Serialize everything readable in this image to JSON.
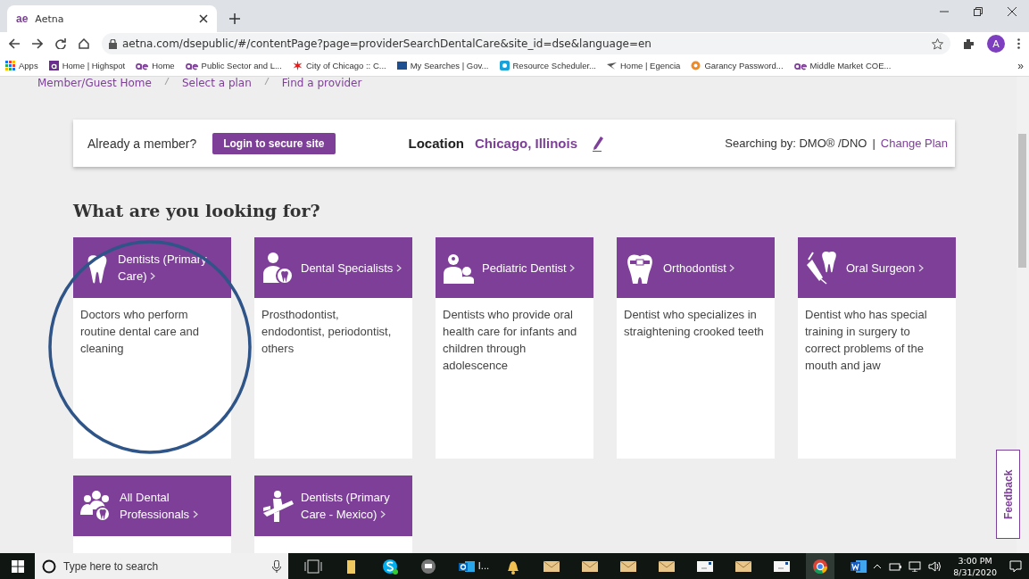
{
  "browser": {
    "tab": {
      "title": "Aetna",
      "logo": "ae"
    },
    "url": "aetna.com/dsepublic/#/contentPage?page=providerSearchDentalCare&site_id=dse&language=en",
    "profile": "A",
    "bookmarks": [
      {
        "label": "Apps",
        "kind": "apps"
      },
      {
        "label": "Home | Highspot",
        "kind": "highspot"
      },
      {
        "label": "Home",
        "kind": "ae"
      },
      {
        "label": "Public Sector and L...",
        "kind": "ae"
      },
      {
        "label": "City of Chicago :: C...",
        "kind": "star"
      },
      {
        "label": "My Searches | Gov...",
        "kind": "gov"
      },
      {
        "label": "Resource Scheduler...",
        "kind": "resource"
      },
      {
        "label": "Home | Egencia",
        "kind": "egencia"
      },
      {
        "label": "Garancy Password...",
        "kind": "garancy"
      },
      {
        "label": "Middle Market COE...",
        "kind": "ae"
      }
    ],
    "more": "»"
  },
  "breadcrumb": [
    "Member/Guest Home",
    "Select a plan",
    "Find a provider"
  ],
  "member_bar": {
    "prompt": "Already a member?",
    "login_button": "Login to secure site",
    "location_label": "Location",
    "location": "Chicago, Illinois",
    "searching_by": "Searching by: DMO® /DNO",
    "separator": "|",
    "change_plan": "Change Plan"
  },
  "heading": "What are you looking for?",
  "cards": [
    {
      "title": "Dentists (Primary Care)",
      "kind": "tooth",
      "description": "Doctors who perform routine dental care and cleaning"
    },
    {
      "title": "Dental Specialists",
      "kind": "specialist",
      "description": "Prosthodontist, endodontist, periodontist, others"
    },
    {
      "title": "Pediatric Dentist",
      "kind": "pediatric",
      "description": "Dentists who provide oral health care for infants and children through adolescence"
    },
    {
      "title": "Orthodontist",
      "kind": "braces",
      "description": "Dentist who specializes in straightening crooked teeth"
    },
    {
      "title": "Oral Surgeon",
      "kind": "surgeon",
      "description": "Dentist who has special training in surgery to correct problems of the mouth and jaw"
    },
    {
      "title": "All Dental Professionals",
      "kind": "group"
    },
    {
      "title": "Dentists (Primary Care - Mexico)",
      "kind": "chair"
    }
  ],
  "feedback": "Feedback",
  "taskbar": {
    "search_placeholder": "Type here to search",
    "outlook_label": "I...",
    "time": "3:00 PM",
    "date": "8/31/2020",
    "apps": [
      {
        "kind": "bell"
      },
      {
        "kind": "mail"
      },
      {
        "kind": "mail"
      },
      {
        "kind": "mail"
      },
      {
        "kind": "mail"
      },
      {
        "kind": "envelope"
      },
      {
        "kind": "mail"
      },
      {
        "kind": "envelope"
      },
      {
        "kind": "chrome"
      },
      {
        "kind": "word"
      }
    ]
  }
}
